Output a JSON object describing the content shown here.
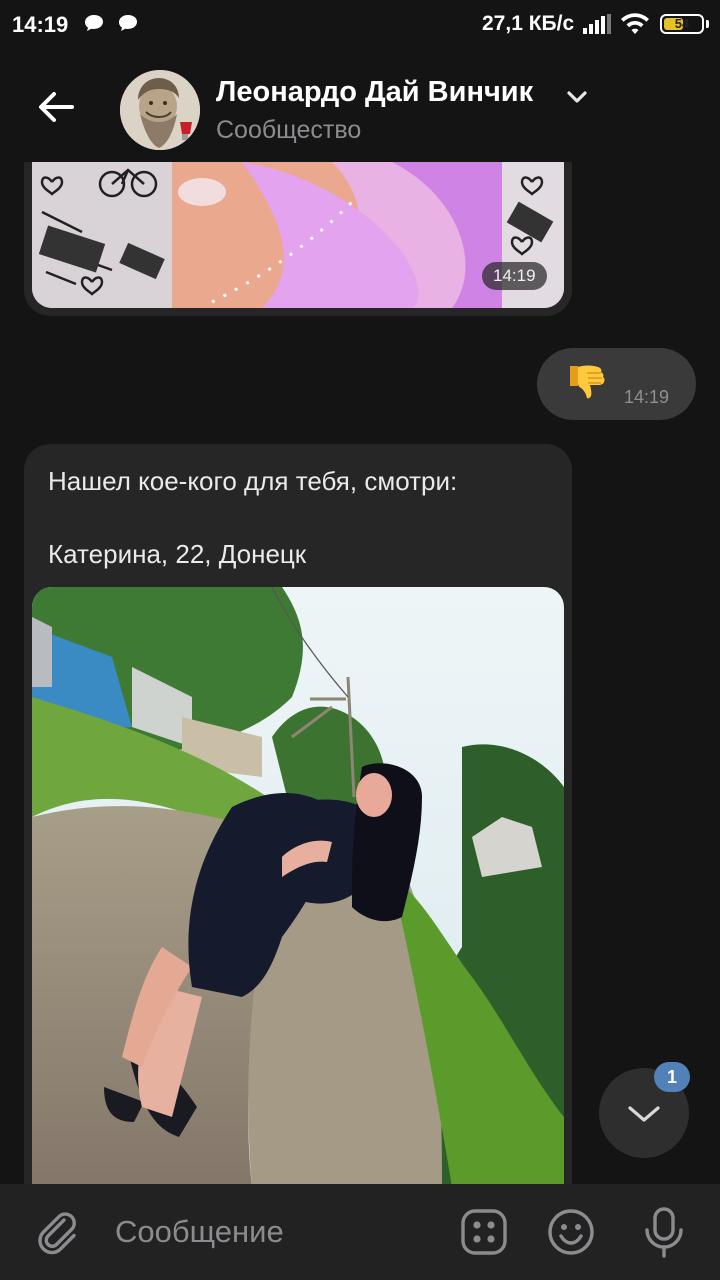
{
  "status_bar": {
    "time": "14:19",
    "network_speed": "27,1 КБ/с",
    "battery_level": "54",
    "battery_fraction": 0.54,
    "icons": [
      "chat-bubble-icon",
      "chat-bubble-icon",
      "signal-icon",
      "wifi-icon",
      "battery-icon"
    ]
  },
  "header": {
    "title": "Леонардо Дай Винчик",
    "subtitle": "Сообщество",
    "back_icon": "arrow-left-icon",
    "dropdown_icon": "chevron-down-icon"
  },
  "messages": [
    {
      "direction": "incoming",
      "type": "photo",
      "time": "14:19"
    },
    {
      "direction": "outgoing",
      "type": "emoji",
      "emoji": "👎",
      "time": "14:19"
    },
    {
      "direction": "incoming",
      "type": "text+photo",
      "lines": [
        "Нашел кое-кого для тебя, смотри:",
        "Катерина, 22, Донецк"
      ]
    }
  ],
  "scroll_down": {
    "icon": "chevron-down-icon",
    "unread_count": "1"
  },
  "composer": {
    "placeholder": "Сообщение",
    "icons": [
      "paperclip-icon",
      "stickers-icon",
      "smile-icon",
      "microphone-icon"
    ]
  },
  "colors": {
    "background": "#141414",
    "incoming_bubble": "#262626",
    "outgoing_bubble": "#3a3a3a",
    "badge": "#5181b8",
    "composer": "#222222"
  }
}
